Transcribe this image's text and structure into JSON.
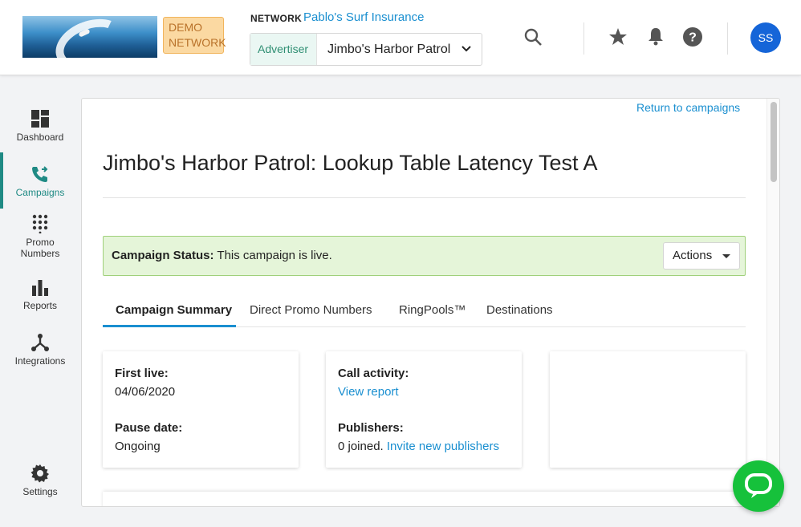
{
  "header": {
    "demo_badge": "DEMO NETWORK",
    "network_label": "NETWORK",
    "network_name": "Pablo's Surf Insurance",
    "advertiser_tag": "Advertiser",
    "advertiser_value": "Jimbo's Harbor Patrol",
    "user_initials": "SS"
  },
  "sidebar": {
    "items": [
      {
        "label": "Dashboard",
        "icon": "dashboard-icon"
      },
      {
        "label": "Campaigns",
        "icon": "phone-forward-icon"
      },
      {
        "label": "Promo Numbers",
        "icon": "keypad-icon"
      },
      {
        "label": "Reports",
        "icon": "bar-chart-icon"
      },
      {
        "label": "Integrations",
        "icon": "integrations-icon"
      },
      {
        "label": "Settings",
        "icon": "gear-icon"
      }
    ]
  },
  "main": {
    "return_link": "Return to campaigns",
    "title": "Jimbo's Harbor Patrol: Lookup Table Latency Test A",
    "status_label": "Campaign Status:",
    "status_text": "This campaign is live.",
    "actions_label": "Actions",
    "tabs": [
      {
        "label": "Campaign Summary"
      },
      {
        "label": "Direct Promo Numbers"
      },
      {
        "label": "RingPools™"
      },
      {
        "label": "Destinations"
      }
    ],
    "summary": {
      "first_live_label": "First live:",
      "first_live_value": "04/06/2020",
      "pause_date_label": "Pause date:",
      "pause_date_value": "Ongoing",
      "call_activity_label": "Call activity:",
      "call_activity_link": "View report",
      "publishers_label": "Publishers:",
      "publishers_value": "0 joined.",
      "publishers_link": "Invite new publishers"
    }
  },
  "colors": {
    "accent": "#1f8a84",
    "link": "#1a8fd0",
    "status_bg": "#e5f5d9",
    "avatar": "#1565d8",
    "chat": "#16c13b"
  }
}
